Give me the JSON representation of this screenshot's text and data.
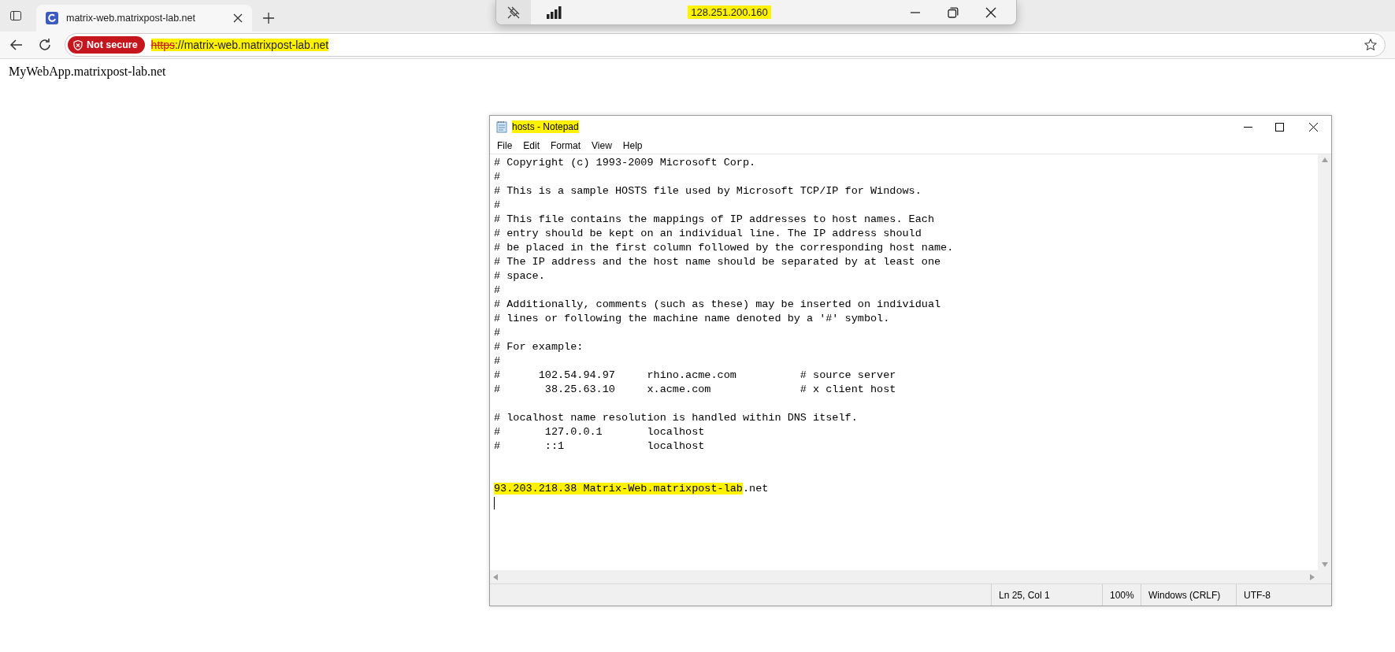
{
  "browser": {
    "tab": {
      "title": "matrix-web.matrixpost-lab.net",
      "selected": true
    },
    "address_bar": {
      "security_badge": "Not secure",
      "scheme": "https",
      "url_rest": "://matrix-web.matrixpost-lab.net",
      "highlighted": true
    }
  },
  "page": {
    "text": "MyWebApp.matrixpost-lab.net"
  },
  "remote_session_bar": {
    "host": "128.251.200.160",
    "highlighted": true
  },
  "notepad": {
    "title": "hosts - Notepad",
    "title_highlighted": true,
    "menu": [
      "File",
      "Edit",
      "Format",
      "View",
      "Help"
    ],
    "text_lines": [
      "# Copyright (c) 1993-2009 Microsoft Corp.",
      "#",
      "# This is a sample HOSTS file used by Microsoft TCP/IP for Windows.",
      "#",
      "# This file contains the mappings of IP addresses to host names. Each",
      "# entry should be kept on an individual line. The IP address should",
      "# be placed in the first column followed by the corresponding host name.",
      "# The IP address and the host name should be separated by at least one",
      "# space.",
      "#",
      "# Additionally, comments (such as these) may be inserted on individual",
      "# lines or following the machine name denoted by a '#' symbol.",
      "#",
      "# For example:",
      "#",
      "#      102.54.94.97     rhino.acme.com          # source server",
      "#       38.25.63.10     x.acme.com              # x client host"
    ],
    "localhost_lines": [
      "# localhost name resolution is handled within DNS itself.",
      "#\t127.0.0.1       localhost",
      "#\t::1             localhost"
    ],
    "added_entry": {
      "highlighted_part": "93.203.218.38 Matrix-Web.matrixpost-lab",
      "rest": ".net"
    },
    "status_bar": {
      "position": "Ln 25, Col 1",
      "zoom": "100%",
      "line_ending": "Windows (CRLF)",
      "encoding": "UTF-8"
    }
  }
}
